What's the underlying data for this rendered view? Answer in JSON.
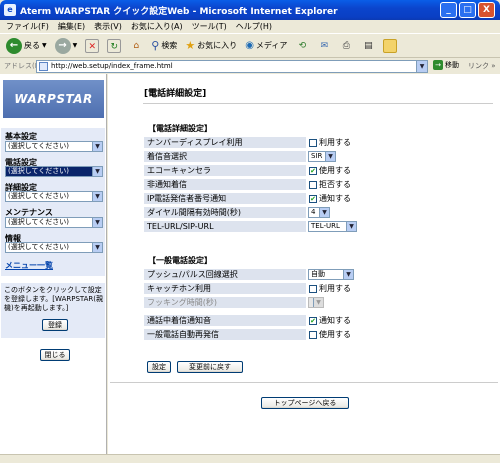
{
  "window": {
    "title": "Aterm WARPSTAR クイック設定Web - Microsoft Internet Explorer",
    "minimize": "_",
    "maximize": "□",
    "close": "X"
  },
  "menu": [
    "ファイル(F)",
    "編集(E)",
    "表示(V)",
    "お気に入り(A)",
    "ツール(T)",
    "ヘルプ(H)"
  ],
  "toolbar": {
    "back": "戻る",
    "search": "検索",
    "favorites": "お気に入り",
    "media": "メディア"
  },
  "address": {
    "label": "アドレス(D)",
    "url": "http://web.setup/index_frame.html",
    "go": "移動",
    "links": "リンク »"
  },
  "sidebar": {
    "logo": "WARPSTAR",
    "groups": [
      {
        "label": "基本設定",
        "select": "(選択してください)"
      },
      {
        "label": "電話設定",
        "select": "(選択してください)"
      },
      {
        "label": "詳細設定",
        "select": "(選択してください)"
      },
      {
        "label": "メンテナンス",
        "select": "(選択してください)"
      },
      {
        "label": "情報",
        "select": "(選択してください)"
      }
    ],
    "menu_list": "メニュー一覧",
    "register_note": "このボタンをクリックして設定を登録します。[WARPSTAR(親機)を再起動します。]",
    "register_button": "登録",
    "close_button": "閉じる"
  },
  "main": {
    "page_title": "[電話詳細設定]",
    "section1": "【電話詳細設定】",
    "section2": "【一般電話設定】",
    "rows1": [
      {
        "label": "ナンバーディスプレイ利用",
        "value": "利用する"
      },
      {
        "label": "着信音選択",
        "value": "SIR"
      },
      {
        "label": "エコーキャンセラ",
        "value": "使用する"
      },
      {
        "label": "非通知着信",
        "value": "拒否する"
      },
      {
        "label": "IP電話発信者番号通知",
        "value": "通知する"
      },
      {
        "label": "ダイヤル間隔有効時間(秒)",
        "value": "4"
      },
      {
        "label": "TEL-URL/SIP-URL",
        "value": "TEL-URL"
      }
    ],
    "rows2": [
      {
        "label": "プッシュ/パルス回線選択",
        "value": "自動"
      },
      {
        "label": "キャッチホン利用",
        "value": "利用する"
      },
      {
        "label": "フッキング時間(秒)",
        "value": ""
      },
      {
        "label": "通話中着信通知音",
        "value": "通知する"
      },
      {
        "label": "一般電話自動再発信",
        "value": "使用する"
      }
    ],
    "set_button": "設定",
    "revert_button": "変更前に戻す",
    "top_button": "トップページへ戻る"
  }
}
